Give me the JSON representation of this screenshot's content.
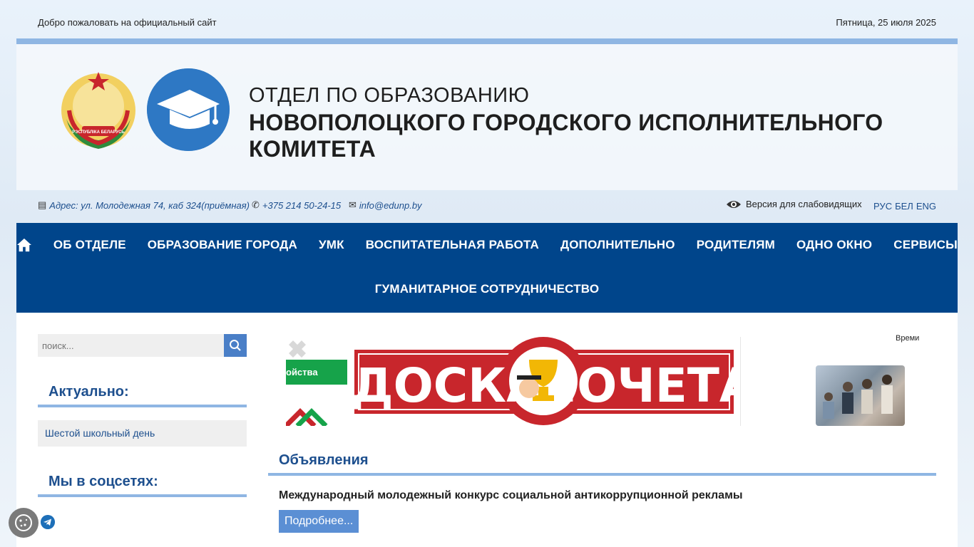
{
  "topbar": {
    "welcome": "Добро пожаловать на официальный сайт",
    "date": "Пятница, 25 июля 2025"
  },
  "header": {
    "title_line1": "ОТДЕЛ ПО ОБРАЗОВАНИЮ",
    "title_line2": "НОВОПОЛОЦКОГО ГОРОДСКОГО ИСПОЛНИТЕЛЬНОГО КОМИТЕТА",
    "emblem_text": "РЭСПУБЛІКА БЕЛАРУСЬ"
  },
  "contacts": {
    "address": "Адрес: ул. Молодежная 74, каб 324(приёмная)",
    "phone": "+375 214 50-24-15",
    "email": "info@edunp.by",
    "visually_impaired": "Версия для слабовидящих",
    "langs": [
      "РУС",
      "БЕЛ",
      "ENG"
    ]
  },
  "nav": {
    "row1": [
      "ОБ ОТДЕЛЕ",
      "ОБРАЗОВАНИЕ ГОРОДА",
      "УМК",
      "ВОСПИТАТЕЛЬНАЯ РАБОТА",
      "ДОПОЛНИТЕЛЬНО",
      "РОДИТЕЛЯМ",
      "ОДНО ОКНО",
      "СЕРВИСЫ"
    ],
    "row2": [
      "ГУМАНИТАРНОЕ СОТРУДНИЧЕСТВО"
    ]
  },
  "sidebar": {
    "search_placeholder": "поиск...",
    "actual_heading": "Актуально:",
    "actual_link": "Шестой школьный день",
    "social_heading": "Мы в соцсетях:"
  },
  "banners": {
    "green_text": "ойства",
    "doska_left": "ДОСКА",
    "doska_right": "ПОЧЕТА",
    "vremya": "Времи"
  },
  "announcements": {
    "heading": "Объявления",
    "item_title": "Международный молодежный конкурс социальной антикоррупционной рекламы",
    "more_label": "Подробнее..."
  },
  "colors": {
    "nav_bg": "#00458b",
    "accent_line": "#8fb6e3",
    "link": "#1d4f8e",
    "button": "#5b8fd4",
    "doska_red": "#c8262c"
  }
}
